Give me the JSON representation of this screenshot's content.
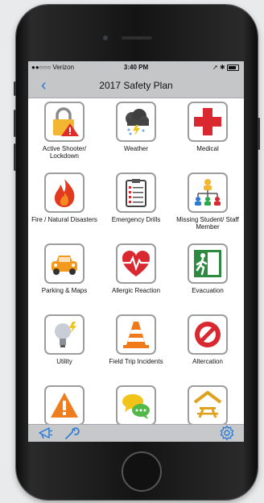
{
  "status": {
    "carrier": "●●○○○ Verizon",
    "time": "3:40 PM",
    "right": "➚ ✱"
  },
  "nav": {
    "back": "‹",
    "title": "2017 Safety Plan"
  },
  "tiles": [
    {
      "label": "Active Shooter/ Lockdown",
      "icon": "lock-warning-icon"
    },
    {
      "label": "Weather",
      "icon": "storm-cloud-icon"
    },
    {
      "label": "Medical",
      "icon": "red-cross-icon"
    },
    {
      "label": "Fire / Natural Disasters",
      "icon": "fire-icon"
    },
    {
      "label": "Emergency Drills",
      "icon": "checklist-icon"
    },
    {
      "label": "Missing Student/ Staff Member",
      "icon": "org-chart-icon"
    },
    {
      "label": "Parking & Maps",
      "icon": "car-icon"
    },
    {
      "label": "Allergic Reaction",
      "icon": "heartbeat-icon"
    },
    {
      "label": "Evacuation",
      "icon": "exit-icon"
    },
    {
      "label": "Utility",
      "icon": "lightbulb-icon"
    },
    {
      "label": "Field Trip Incidents",
      "icon": "traffic-cone-icon"
    },
    {
      "label": "Altercation",
      "icon": "no-entry-icon"
    },
    {
      "label": "",
      "icon": "warning-triangle-icon"
    },
    {
      "label": "",
      "icon": "chat-bubbles-icon"
    },
    {
      "label": "",
      "icon": "picnic-table-icon"
    }
  ],
  "toolbar": {
    "left_icons": [
      "megaphone-icon",
      "wrench-icon"
    ],
    "right_icon": "gear-icon"
  },
  "colors": {
    "accent": "#2a7ad8",
    "bar": "#c5c6c8"
  }
}
